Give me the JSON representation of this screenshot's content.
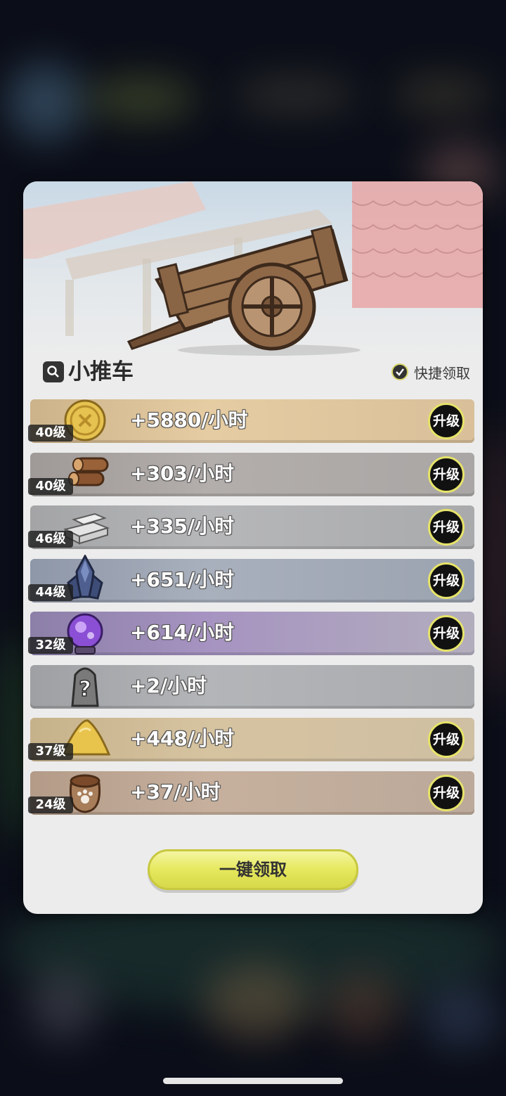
{
  "panel": {
    "title": "小推车",
    "quick_claim_label": "快捷领取",
    "claim_all_label": "一键领取"
  },
  "resources": [
    {
      "level": "40级",
      "rate": "+5880/小时",
      "upgrade": "升级",
      "icon": "gold-coin-icon",
      "color": "#d9bd8f"
    },
    {
      "level": "40级",
      "rate": "+303/小时",
      "upgrade": "升级",
      "icon": "wood-logs-icon",
      "color": "#a7a3a2"
    },
    {
      "level": "46级",
      "rate": "+335/小时",
      "upgrade": "升级",
      "icon": "stone-bricks-icon",
      "color": "#a8a9ab"
    },
    {
      "level": "44级",
      "rate": "+651/小时",
      "upgrade": "升级",
      "icon": "crystal-ore-icon",
      "color": "#9aa3b3"
    },
    {
      "level": "32级",
      "rate": "+614/小时",
      "upgrade": "升级",
      "icon": "magic-orb-icon",
      "color": "#9a8ab5"
    },
    {
      "level": "",
      "rate": "+2/小时",
      "upgrade": "",
      "icon": "mystery-item-icon",
      "color": "#a6a8ab"
    },
    {
      "level": "37级",
      "rate": "+448/小时",
      "upgrade": "升级",
      "icon": "sand-pile-icon",
      "color": "#cdb991"
    },
    {
      "level": "24级",
      "rate": "+37/小时",
      "upgrade": "升级",
      "icon": "paw-sack-icon",
      "color": "#b9a391"
    }
  ]
}
